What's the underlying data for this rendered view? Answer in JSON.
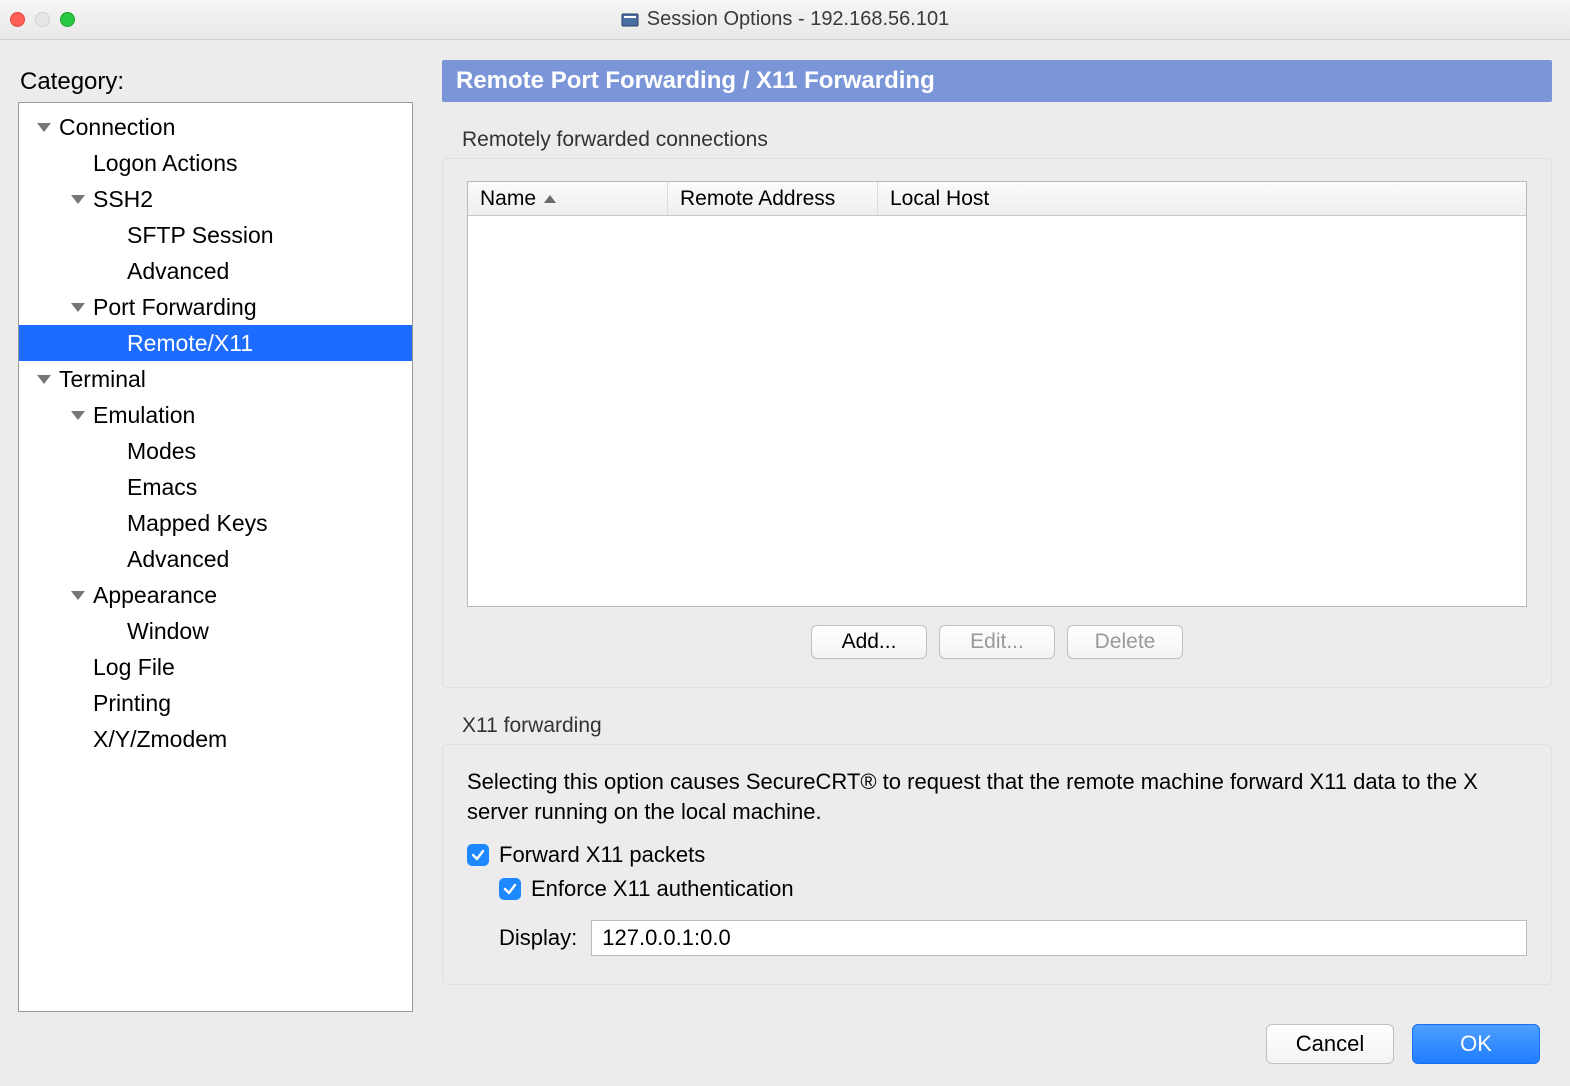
{
  "window": {
    "title": "Session Options - 192.168.56.101"
  },
  "sidebar": {
    "heading": "Category:",
    "tree": {
      "connection": "Connection",
      "logon_actions": "Logon Actions",
      "ssh2": "SSH2",
      "sftp_session": "SFTP Session",
      "ssh2_advanced": "Advanced",
      "port_forwarding": "Port Forwarding",
      "remote_x11": "Remote/X11",
      "terminal": "Terminal",
      "emulation": "Emulation",
      "modes": "Modes",
      "emacs": "Emacs",
      "mapped_keys": "Mapped Keys",
      "emu_advanced": "Advanced",
      "appearance": "Appearance",
      "window": "Window",
      "log_file": "Log File",
      "printing": "Printing",
      "xyzmodem": "X/Y/Zmodem"
    }
  },
  "panel": {
    "title": "Remote Port Forwarding / X11 Forwarding"
  },
  "remote_forward": {
    "group_label": "Remotely forwarded connections",
    "columns": {
      "name": "Name",
      "remote_addr": "Remote Address",
      "local_host": "Local Host"
    },
    "rows": [],
    "buttons": {
      "add": "Add...",
      "edit": "Edit...",
      "delete": "Delete"
    }
  },
  "x11": {
    "group_label": "X11 forwarding",
    "description": "Selecting this option causes SecureCRT® to request that the remote machine forward X11 data to the X server running on the local machine.",
    "forward_label": "Forward X11 packets",
    "forward_checked": true,
    "enforce_label": "Enforce X11 authentication",
    "enforce_checked": true,
    "display_label": "Display:",
    "display_value": "127.0.0.1:0.0"
  },
  "footer": {
    "cancel": "Cancel",
    "ok": "OK"
  }
}
